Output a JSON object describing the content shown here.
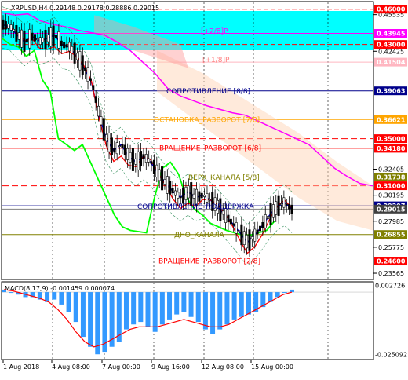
{
  "header": {
    "symbol_line": "XRPUSD,H4  0.29148 0.29178 0.28886 0.29015",
    "macd_line": "MACD(8,17,9) -0.001459 0.000074"
  },
  "colors": {
    "background": "#ffffff",
    "cyan_zone": "#00ffff",
    "resistance_blue": "#00008b",
    "orange": "#ffa500",
    "red": "#ff0000",
    "olive": "#808000",
    "macd_hist": "#3399ff",
    "macd_signal": "#ff0000",
    "green_line": "#00ff00",
    "magenta_line": "#ff00ff"
  },
  "chart_data": [
    {
      "type": "line",
      "title": "XRPUSD,H4  0.29148 0.29178 0.28886 0.29015",
      "y_axis_ticks": [
        "0.45535",
        "0.42425",
        "0.32405",
        "0.30195",
        "0.27985",
        "0.25775",
        "0.23565"
      ],
      "price_boxes": [
        {
          "label": "0.46000",
          "color": "#ff0000"
        },
        {
          "label": "0.43945",
          "color": "#ff00ff"
        },
        {
          "label": "0.43000",
          "color": "#ff0000"
        },
        {
          "label": "0.41504",
          "color": "#ffb6c1"
        },
        {
          "label": "0.39063",
          "color": "#00008b"
        },
        {
          "label": "0.36621",
          "color": "#ffa500"
        },
        {
          "label": "0.35000",
          "color": "#ff0000"
        },
        {
          "label": "0.34180",
          "color": "#ff0000"
        },
        {
          "label": "0.31738",
          "color": "#808000"
        },
        {
          "label": "0.31000",
          "color": "#ff0000"
        },
        {
          "label": "0.29297",
          "color": "#00008b"
        },
        {
          "label": "0.29015",
          "color": "#404040"
        },
        {
          "label": "0.26855",
          "color": "#808000"
        },
        {
          "label": "0.24600",
          "color": "#ff0000"
        }
      ],
      "levels": [
        {
          "label": "[+2/8]P",
          "color": "#ff00ff"
        },
        {
          "label": "[+1/8]P",
          "color": "#ff8080"
        },
        {
          "label": "СОПРОТИВЛЕНИЕ [8/8]",
          "color": "#00008b"
        },
        {
          "label": "ОСТАНОВКА_РАЗВОРОТ [7/8]",
          "color": "#ffa500"
        },
        {
          "label": "ВРАЩЕНИЕ_РАЗВОРОТ [6/8]",
          "color": "#ff0000"
        },
        {
          "label": "ВЕРХ_КАНАЛА [5/8]",
          "color": "#808000"
        },
        {
          "label": "СОПРОТИВЛЕНИЕ_ПОДДЕРЖКА",
          "color": "#00008b"
        },
        {
          "label": "ДНО_КАНАЛА",
          "color": "#808000"
        },
        {
          "label": "ВРАЩЕНИЕ_РАЗВОРОТ [2/8]",
          "color": "#ff0000"
        }
      ],
      "x_labels": [
        "1 Aug 2018",
        "4 Aug 08:00",
        "7 Aug 00:00",
        "9 Aug 16:00",
        "12 Aug 08:00",
        "15 Aug 00:00"
      ],
      "series": [
        {
          "values": [
            0.447,
            0.445,
            0.438,
            0.432,
            0.437,
            0.433,
            0.435,
            0.438,
            0.43,
            0.428,
            0.42,
            0.41,
            0.398,
            0.37,
            0.35,
            0.34,
            0.345,
            0.335,
            0.33,
            0.335,
            0.33,
            0.32,
            0.312,
            0.305,
            0.3,
            0.305,
            0.3,
            0.302,
            0.298,
            0.292,
            0.285,
            0.278,
            0.27,
            0.262,
            0.268,
            0.276,
            0.285,
            0.292,
            0.296,
            0.29
          ]
        },
        {
          "values": [
            0.435,
            0.43,
            0.428,
            0.42,
            0.425,
            0.4,
            0.39,
            0.35,
            0.345,
            0.34,
            0.345,
            0.33,
            0.315,
            0.3,
            0.285,
            0.275,
            0.272,
            0.271,
            0.27,
            0.3,
            0.325,
            0.33,
            0.32,
            0.3,
            0.29,
            0.285,
            0.278,
            0.275,
            0.272,
            0.27,
            0.268,
            0.268,
            0.27,
            0.272,
            0.28
          ]
        },
        {
          "values": [
            0.457,
            0.455,
            0.456,
            0.45,
            0.447,
            0.445,
            0.442,
            0.44,
            0.438,
            0.432,
            0.425,
            0.415,
            0.405,
            0.392,
            0.386,
            0.382,
            0.378,
            0.375,
            0.372,
            0.37,
            0.365,
            0.36,
            0.355,
            0.35,
            0.345,
            0.335,
            0.325,
            0.318,
            0.312,
            0.31
          ]
        }
      ]
    },
    {
      "type": "bar",
      "title": "MACD(8,17,9) -0.001459 0.000074",
      "y_axis_ticks": [
        "0.002726",
        "-0.025092"
      ],
      "series": [
        {
          "name": "histogram",
          "values": [
            0.001,
            0.0,
            -0.001,
            -0.002,
            -0.002,
            -0.003,
            -0.004,
            -0.003,
            -0.005,
            -0.008,
            -0.012,
            -0.018,
            -0.022,
            -0.025,
            -0.024,
            -0.022,
            -0.02,
            -0.015,
            -0.013,
            -0.012,
            -0.014,
            -0.016,
            -0.013,
            -0.011,
            -0.009,
            -0.008,
            -0.01,
            -0.012,
            -0.015,
            -0.017,
            -0.015,
            -0.013,
            -0.011,
            -0.01,
            -0.009,
            -0.008,
            -0.006,
            -0.004,
            -0.002,
            0.0,
            0.001
          ]
        },
        {
          "name": "signal",
          "values": [
            0.001,
            0.0005,
            -0.0005,
            -0.0015,
            -0.0025,
            -0.004,
            -0.007,
            -0.011,
            -0.016,
            -0.02,
            -0.022,
            -0.021,
            -0.019,
            -0.017,
            -0.015,
            -0.014,
            -0.014,
            -0.014,
            -0.013,
            -0.012,
            -0.011,
            -0.012,
            -0.013,
            -0.014,
            -0.014,
            -0.013,
            -0.011,
            -0.009,
            -0.007,
            -0.005,
            -0.003,
            -0.001,
            0.0
          ]
        }
      ]
    }
  ]
}
